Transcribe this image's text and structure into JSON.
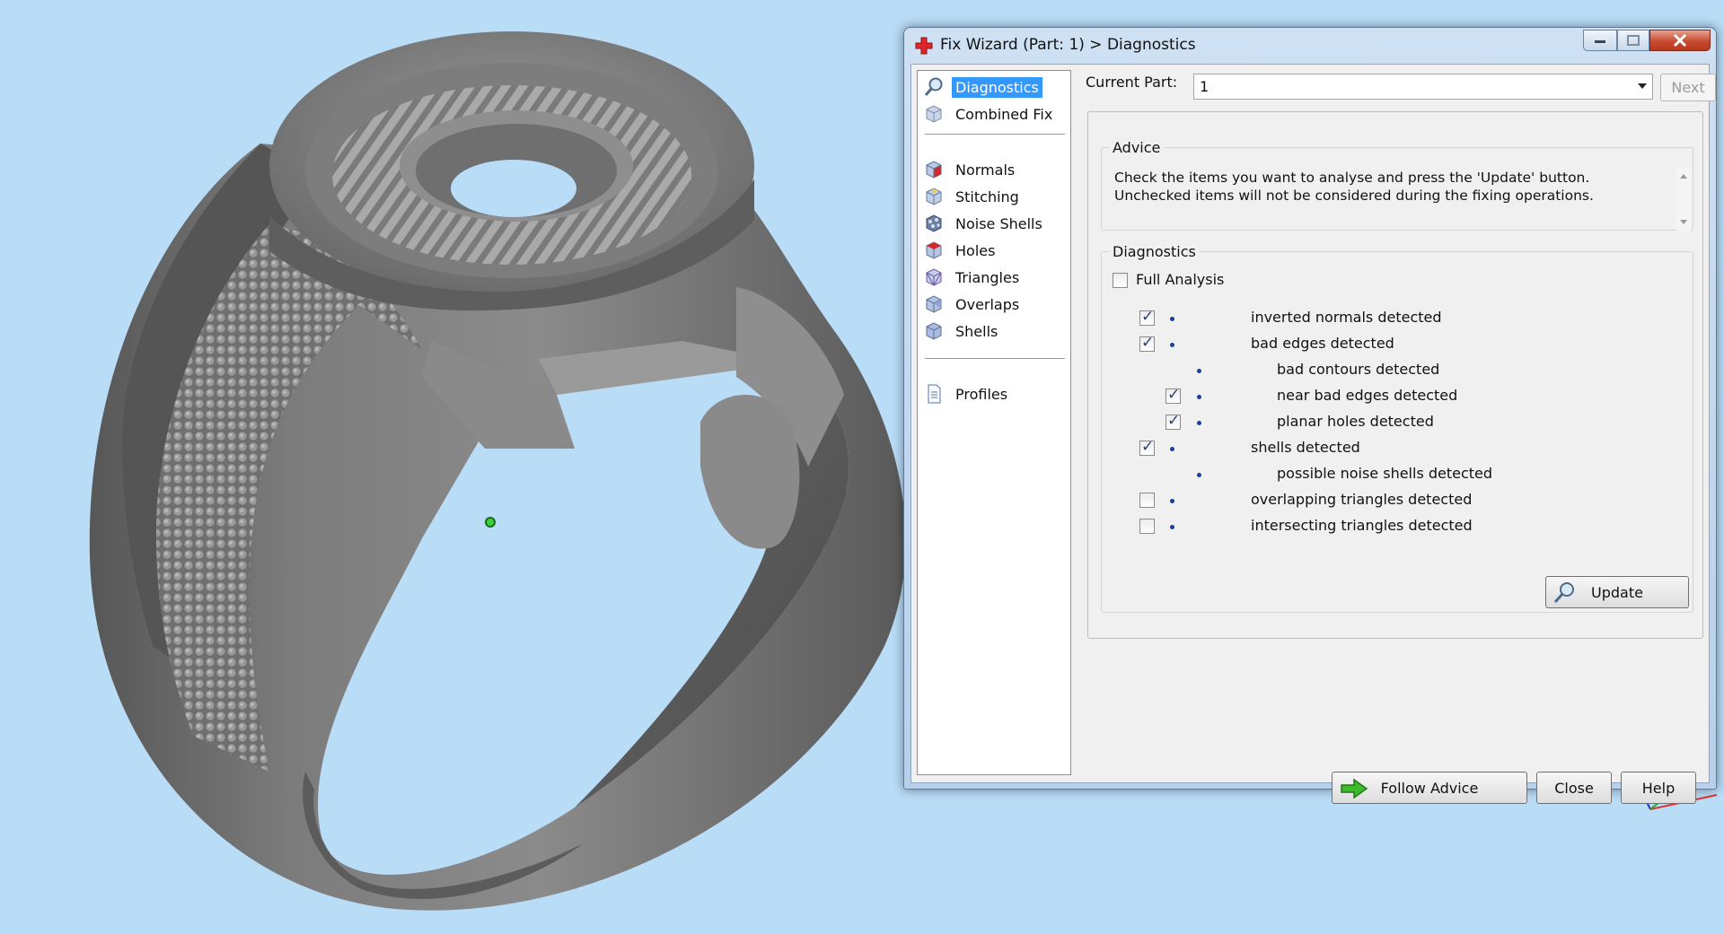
{
  "window": {
    "title": "Fix Wizard (Part: 1) > Diagnostics"
  },
  "nav": {
    "items": [
      {
        "label": "Diagnostics",
        "icon": "magnifier-icon",
        "selected": true
      },
      {
        "label": "Combined Fix",
        "icon": "cube-icon"
      },
      {
        "label": "Normals",
        "icon": "normals-cube-icon"
      },
      {
        "label": "Stitching",
        "icon": "stitching-cube-icon"
      },
      {
        "label": "Noise Shells",
        "icon": "noise-shells-icon"
      },
      {
        "label": "Holes",
        "icon": "holes-cube-icon"
      },
      {
        "label": "Triangles",
        "icon": "triangles-cube-icon"
      },
      {
        "label": "Overlaps",
        "icon": "overlaps-cube-icon"
      },
      {
        "label": "Shells",
        "icon": "shells-cube-icon"
      },
      {
        "label": "Profiles",
        "icon": "document-icon"
      }
    ]
  },
  "header": {
    "current_part_label": "Current Part:",
    "current_part_value": "1",
    "next_label": "Next"
  },
  "advice": {
    "title": "Advice",
    "text": "Check the items you want to analyse and press the 'Update' button. Unchecked items will not be considered during the fixing operations."
  },
  "diagnostics": {
    "title": "Diagnostics",
    "full_analysis_label": "Full Analysis",
    "full_analysis_checked": false,
    "items": [
      {
        "label": "inverted normals detected",
        "checked": true,
        "has_checkbox": true,
        "level": 0
      },
      {
        "label": "bad edges detected",
        "checked": true,
        "has_checkbox": true,
        "level": 0
      },
      {
        "label": "bad contours detected",
        "checked": false,
        "has_checkbox": false,
        "level": 1
      },
      {
        "label": "near bad edges detected",
        "checked": true,
        "has_checkbox": true,
        "level": 1
      },
      {
        "label": "planar holes detected",
        "checked": true,
        "has_checkbox": true,
        "level": 1
      },
      {
        "label": "shells detected",
        "checked": true,
        "has_checkbox": true,
        "level": 0
      },
      {
        "label": "possible noise shells detected",
        "checked": false,
        "has_checkbox": false,
        "level": 1
      },
      {
        "label": "overlapping triangles detected",
        "checked": false,
        "has_checkbox": true,
        "level": 0
      },
      {
        "label": "intersecting triangles detected",
        "checked": false,
        "has_checkbox": true,
        "level": 0
      }
    ],
    "update_label": "Update"
  },
  "footer": {
    "follow_advice_label": "Follow Advice",
    "close_label": "Close",
    "help_label": "Help"
  },
  "colors": {
    "viewport_background": "#b9dcf7",
    "selection": "#3399ff",
    "bullet": "#1c3e9e",
    "model": "#6e6e6e",
    "follow_arrow": "#3cba2b"
  }
}
